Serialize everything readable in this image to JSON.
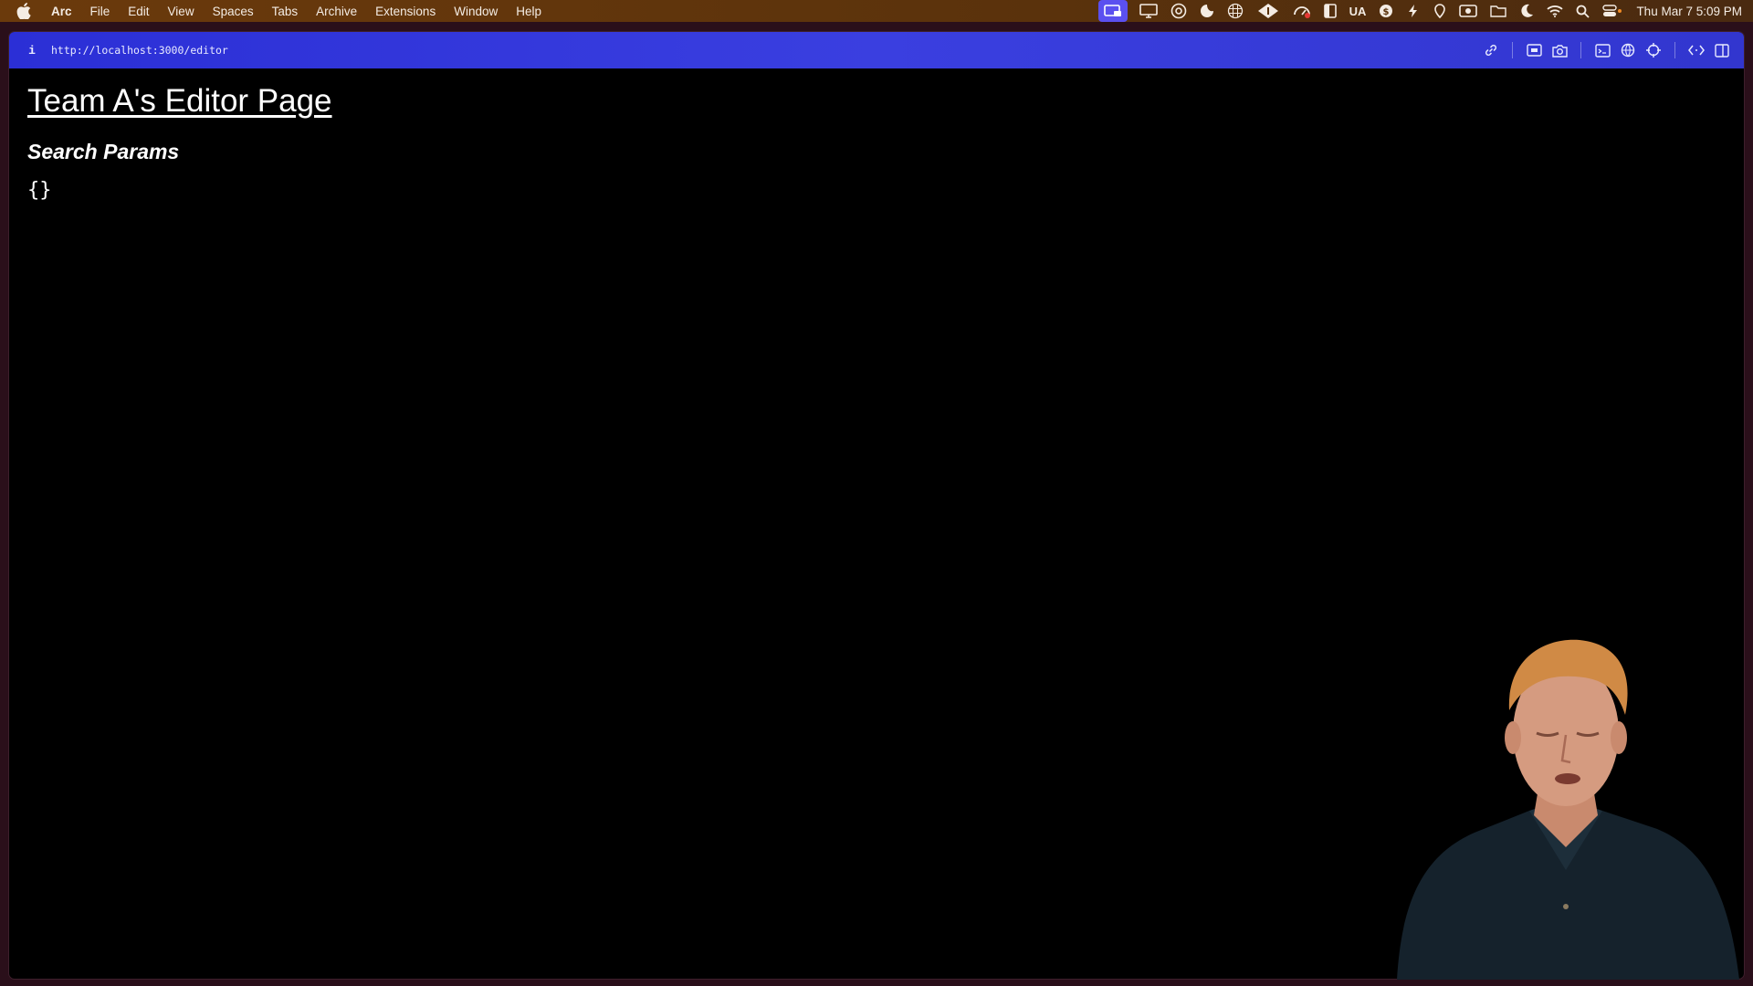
{
  "menubar": {
    "app_name": "Arc",
    "items": [
      "File",
      "Edit",
      "View",
      "Spaces",
      "Tabs",
      "Archive",
      "Extensions",
      "Window",
      "Help"
    ],
    "status_text_badge": "UA",
    "clock": "Thu Mar 7  5:09 PM",
    "icons": [
      "apple-icon",
      "screen-share-icon",
      "display-icon",
      "at-sign-icon",
      "moon-app-icon",
      "globe-grid-icon",
      "diamond-icon",
      "gauge-icon",
      "sidebar-icon",
      "dollar-icon",
      "bolt-icon",
      "location-icon",
      "video-icon",
      "folder-icon",
      "moon-icon",
      "wifi-icon",
      "search-icon",
      "control-center-icon"
    ],
    "accent_color": "#5b50f0"
  },
  "browser": {
    "url": "http://localhost:3000/editor",
    "accent_color": "#2b2fd6",
    "tool_icons": [
      "link-icon",
      "capture-icon",
      "camera-icon",
      "terminal-icon",
      "globe-icon",
      "crosshair-icon",
      "code-icon",
      "split-view-icon"
    ]
  },
  "page": {
    "title": "Team A's Editor Page",
    "search_heading": "Search Params",
    "params_json": "{}"
  }
}
